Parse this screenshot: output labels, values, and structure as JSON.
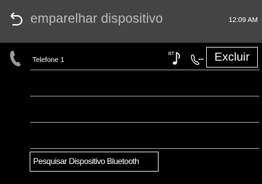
{
  "header": {
    "back_icon": "back-arrow-icon",
    "title": "emparelhar dispositivo",
    "clock": "12:09 AM",
    "background": "#444444",
    "title_color": "#bdbdbd"
  },
  "device_list": {
    "device_icon": "phone-handset-icon",
    "devices": [
      {
        "name": "Telefone 1",
        "profile_icons": [
          "bluetooth-audio-icon",
          "bluetooth-phone-icon"
        ],
        "bt_audio_label": "BT",
        "delete_label": "Excluir"
      }
    ],
    "empty_rows": 3
  },
  "search_button_label": "Pesquisar Dispositivo Bluetooth",
  "colors": {
    "background": "#000000",
    "text": "#ffffff",
    "divider": "#a0a0a0",
    "button_border": "#e0e0e0"
  }
}
